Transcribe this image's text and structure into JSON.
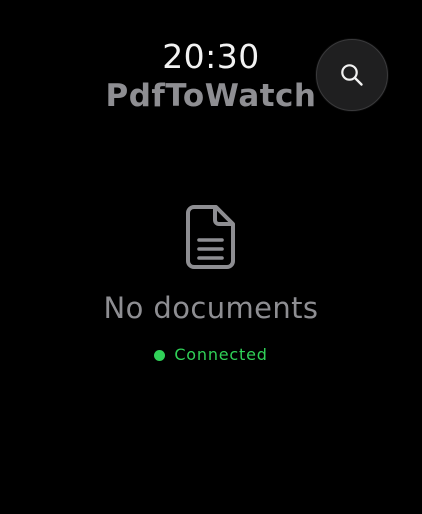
{
  "status_bar": {
    "time": "20:30"
  },
  "header": {
    "app_title": "PdfToWatch",
    "search_button": {
      "icon": "search-icon",
      "aria_label": "Search"
    }
  },
  "empty_state": {
    "icon": "document-icon",
    "message": "No documents",
    "connection": {
      "label": "Connected",
      "color": "#30d158"
    }
  },
  "colors": {
    "background": "#000000",
    "primary_text": "#f2f2f2",
    "secondary_text": "#8e8e92",
    "button_fill": "#1f1f20",
    "accent_green": "#30d158"
  }
}
